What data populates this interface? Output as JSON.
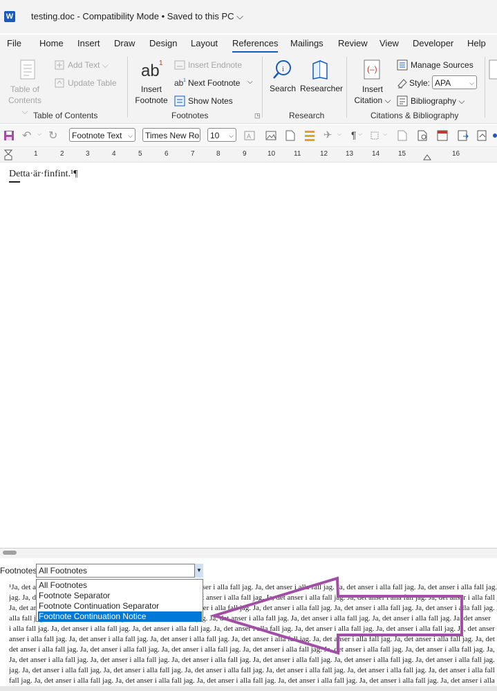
{
  "window": {
    "title": "testing.doc  -  Compatibility Mode • Saved to this PC ⌵",
    "app_icon": "W"
  },
  "tabs": [
    {
      "label": "File"
    },
    {
      "label": "Home"
    },
    {
      "label": "Insert"
    },
    {
      "label": "Draw"
    },
    {
      "label": "Design"
    },
    {
      "label": "Layout"
    },
    {
      "label": "References"
    },
    {
      "label": "Mailings"
    },
    {
      "label": "Review"
    },
    {
      "label": "View"
    },
    {
      "label": "Developer"
    },
    {
      "label": "Help"
    }
  ],
  "active_tab": "References",
  "ribbon": {
    "toc": {
      "table_of_contents": "Table of Contents ⌵",
      "add_text": "Add Text ⌵",
      "update_table": "Update Table",
      "group_label": "Table of Contents"
    },
    "footnotes": {
      "insert_footnote": "Insert Footnote",
      "insert_endnote": "Insert Endnote",
      "next_footnote": "Next Footnote",
      "show_notes": "Show Notes",
      "group_label": "Footnotes"
    },
    "research": {
      "search": "Search",
      "researcher": "Researcher",
      "group_label": "Research"
    },
    "citations": {
      "insert_citation": "Insert Citation ⌵",
      "manage_sources": "Manage Sources",
      "style_label": "Style:",
      "style_value": "APA",
      "bibliography": "Bibliography ⌵",
      "group_label": "Citations & Bibliography"
    }
  },
  "quick_toolbar": {
    "style_value": "Footnote Text",
    "font_value": "Times New Ro",
    "size_value": "10"
  },
  "ruler": {
    "marks": [
      "1",
      "2",
      "3",
      "4",
      "5",
      "6",
      "7",
      "8",
      "9",
      "10",
      "11",
      "12",
      "13",
      "14",
      "15",
      "16"
    ]
  },
  "document": {
    "body_text": "Detta·är·finfint.¹¶"
  },
  "footnote_pane": {
    "label": "Footnotes",
    "selected": "All Footnotes",
    "options": [
      "All Footnotes",
      "Footnote Separator",
      "Footnote Continuation Separator",
      "Footnote Continuation Notice"
    ],
    "highlighted_option": "Footnote Continuation Notice",
    "text_lines": [
      "¹Ja, det anser i alla fall jag. Ja, det anser i alla fall jag. Ja, det anser i alla fall jag. Ja, det anser i alla fall jag. Ja, det anser i alla fall jag. Ja, det anser i alla fall jag. Ja, det anser",
      "jag. Ja, det anser i alla fall jag. Ja, det anser i alla fall jag. Ja, det anser i alla fall jag. Ja, det anser i alla fall jag. Ja, det anser i alla fall jag. Ja, det anser i alla fall jag. Ja, det",
      "Ja, det anser i alla fall jag. Ja, det anser i alla fall jag. Ja, det anser i alla fall jag. Ja, det anser i alla fall jag. Ja, det anser i alla fall jag. Ja, det anser i alla fall jag. Ja, det anser",
      "alla fall jag. Ja, det anser i alla fall jag. Ja, det anser i alla fall jag. Ja, det anser i alla fall jag. Ja, det anser i alla fall jag. Ja, det anser i alla fall jag. Ja, det anser",
      "i alla fall jag. Ja, det anser i alla fall jag. Ja, det anser i alla fall jag. Ja, det anser i alla fall jag. Ja, det anser i alla fall jag. Ja, det anser i alla fall jag. Ja, det anser",
      "anser i alla fall jag. Ja, det anser i alla fall jag. Ja, det anser i alla fall jag. Ja, det anser i alla fall jag. Ja, det anser i alla fall jag. Ja, det anser i alla fall jag. Ja, det",
      "det anser i alla fall jag. Ja, det anser i alla fall jag. Ja, det anser i alla fall jag. Ja, det anser i alla fall jag. Ja, det anser i alla fall jag. Ja, det anser i alla fall jag. Ja,",
      "Ja, det anser i alla fall jag. Ja, det anser i alla fall jag. Ja, det anser i alla fall jag. Ja, det anser i alla fall jag. Ja, det anser i alla fall jag. Ja, det anser i alla fall jag.",
      "jag. Ja, det anser i alla fall jag. Ja, det anser i alla fall jag. Ja, det anser i alla fall jag. Ja, det anser i alla fall jag. Ja, det anser i alla fall jag. Ja, det anser i alla fall",
      "fall jag. Ja, det anser i alla fall jag. Ja, det anser i alla fall jag. Ja, det anser i alla fall jag. Ja, det anser i alla fall jag. Ja, det anser i alla fall jag. Ja, det anser i alla"
    ]
  },
  "colors": {
    "accent": "#185abd",
    "annotation": "#a24ea6",
    "selection": "#0078d7"
  }
}
